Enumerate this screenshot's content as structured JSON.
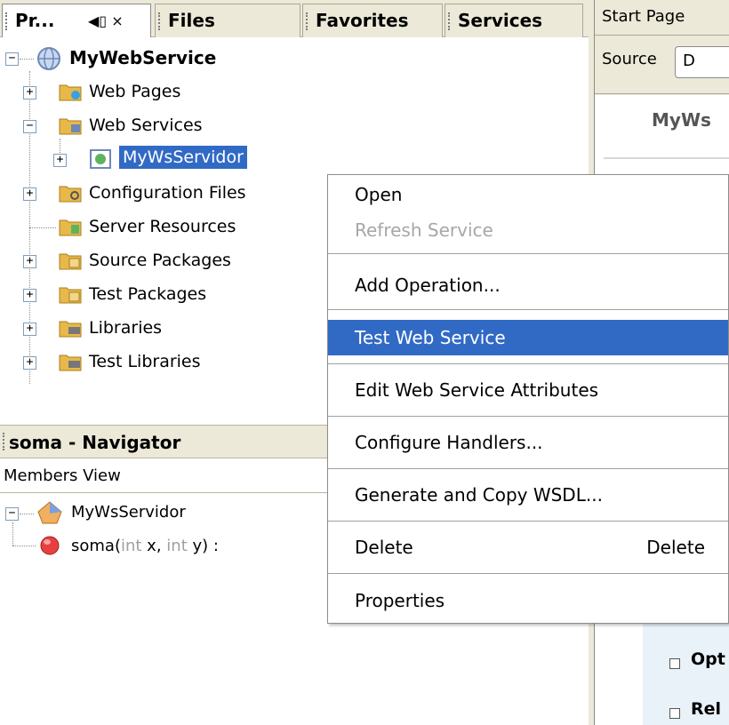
{
  "tabs": {
    "projects": "Pr...",
    "projects_controls": "◀▯ ×",
    "files": "Files",
    "favorites": "Favorites",
    "services": "Services"
  },
  "project_tree": {
    "root": "MyWebService",
    "items": [
      {
        "label": "Web Pages"
      },
      {
        "label": "Web Services"
      },
      {
        "label": "MyWsServidor"
      },
      {
        "label": "Configuration Files"
      },
      {
        "label": "Server Resources"
      },
      {
        "label": "Source Packages"
      },
      {
        "label": "Test Packages"
      },
      {
        "label": "Libraries"
      },
      {
        "label": "Test Libraries"
      }
    ]
  },
  "navigator": {
    "title": "soma - Navigator",
    "view": "Members View",
    "class_name": "MyWsServidor",
    "method_name": "soma(",
    "method_p1_type": "int",
    "method_p1_name": " x, ",
    "method_p2_type": "int",
    "method_p2_name": " y) :"
  },
  "editor": {
    "tab": "Start Page",
    "source_btn": "Source",
    "design_btn": "D",
    "title_partial": "MyWs",
    "option1": "Opt",
    "option2": "Rel"
  },
  "context_menu": {
    "items": [
      {
        "label": "Open",
        "enabled": true
      },
      {
        "label": "Refresh Service",
        "enabled": false
      },
      {
        "label": "Add Operation...",
        "enabled": true
      },
      {
        "label": "Test Web Service",
        "enabled": true,
        "highlighted": true
      },
      {
        "label": "Edit Web Service Attributes",
        "enabled": true
      },
      {
        "label": "Configure Handlers...",
        "enabled": true
      },
      {
        "label": "Generate and Copy WSDL...",
        "enabled": true
      },
      {
        "label": "Delete",
        "enabled": true,
        "accelerator": "Delete"
      },
      {
        "label": "Properties",
        "enabled": true
      }
    ]
  },
  "colors": {
    "selection": "#316ac5",
    "panel": "#ece9d8",
    "folder": "#e8b84a",
    "method_icon": "#e84040"
  }
}
